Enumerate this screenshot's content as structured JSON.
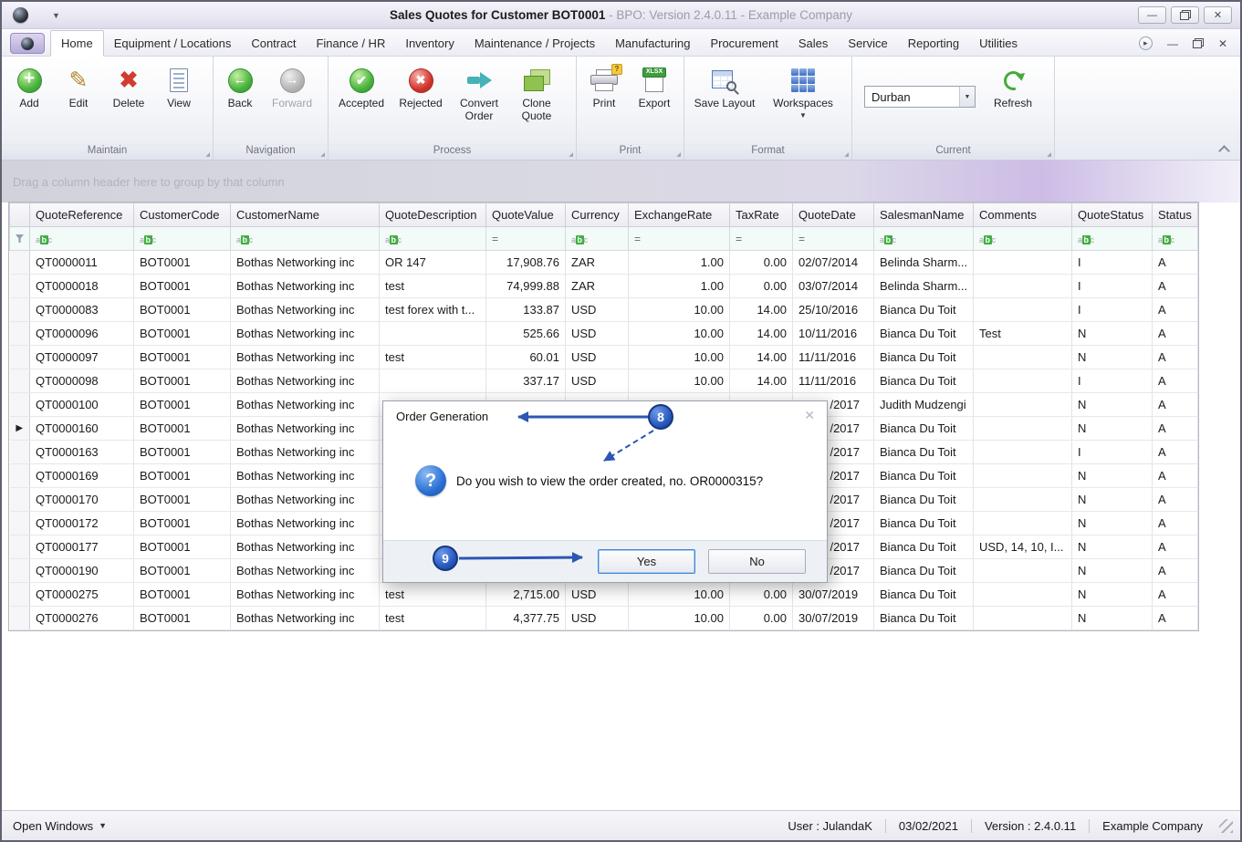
{
  "titlebar": {
    "title_bold": "Sales Quotes for Customer BOT0001",
    "title_rest": " - BPO: Version 2.4.0.11 - Example Company"
  },
  "menu": {
    "tabs": [
      {
        "label": "Home",
        "active": true
      },
      {
        "label": "Equipment / Locations"
      },
      {
        "label": "Contract"
      },
      {
        "label": "Finance / HR"
      },
      {
        "label": "Inventory"
      },
      {
        "label": "Maintenance / Projects"
      },
      {
        "label": "Manufacturing"
      },
      {
        "label": "Procurement"
      },
      {
        "label": "Sales"
      },
      {
        "label": "Service"
      },
      {
        "label": "Reporting"
      },
      {
        "label": "Utilities"
      }
    ]
  },
  "ribbon": {
    "groups": [
      {
        "label": "Maintain",
        "buttons": [
          {
            "label": "Add"
          },
          {
            "label": "Edit"
          },
          {
            "label": "Delete"
          },
          {
            "label": "View"
          }
        ]
      },
      {
        "label": "Navigation",
        "buttons": [
          {
            "label": "Back"
          },
          {
            "label": "Forward"
          }
        ]
      },
      {
        "label": "Process",
        "buttons": [
          {
            "label": "Accepted"
          },
          {
            "label": "Rejected"
          },
          {
            "label": "Convert Order"
          },
          {
            "label": "Clone Quote"
          }
        ]
      },
      {
        "label": "Print",
        "buttons": [
          {
            "label": "Print"
          },
          {
            "label": "Export"
          }
        ]
      },
      {
        "label": "Format",
        "buttons": [
          {
            "label": "Save Layout"
          },
          {
            "label": "Workspaces"
          }
        ]
      },
      {
        "label": "Current",
        "combo_value": "Durban",
        "buttons": [
          {
            "label": "Refresh"
          }
        ]
      }
    ]
  },
  "grid": {
    "group_panel_text": "Drag a column header here to group by that column",
    "columns": [
      {
        "label": "QuoteReference",
        "filter": "abc"
      },
      {
        "label": "CustomerCode",
        "filter": "abc"
      },
      {
        "label": "CustomerName",
        "filter": "abc"
      },
      {
        "label": "QuoteDescription",
        "filter": "abc"
      },
      {
        "label": "QuoteValue",
        "filter": "eq"
      },
      {
        "label": "Currency",
        "filter": "abc"
      },
      {
        "label": "ExchangeRate",
        "filter": "eq"
      },
      {
        "label": "TaxRate",
        "filter": "eq"
      },
      {
        "label": "QuoteDate",
        "filter": "eq"
      },
      {
        "label": "SalesmanName",
        "filter": "abc"
      },
      {
        "label": "Comments",
        "filter": "abc"
      },
      {
        "label": "QuoteStatus",
        "filter": "abc"
      },
      {
        "label": "Status",
        "filter": "abc"
      }
    ],
    "rows": [
      {
        "cells": [
          "QT0000011",
          "BOT0001",
          "Bothas Networking inc",
          "OR 147",
          "17,908.76",
          "ZAR",
          "1.00",
          "0.00",
          "02/07/2014",
          "Belinda Sharm...",
          "",
          "I",
          "A"
        ]
      },
      {
        "cells": [
          "QT0000018",
          "BOT0001",
          "Bothas Networking inc",
          "test",
          "74,999.88",
          "ZAR",
          "1.00",
          "0.00",
          "03/07/2014",
          "Belinda Sharm...",
          "",
          "I",
          "A"
        ]
      },
      {
        "cells": [
          "QT0000083",
          "BOT0001",
          "Bothas Networking inc",
          "test forex with t...",
          "133.87",
          "USD",
          "10.00",
          "14.00",
          "25/10/2016",
          "Bianca Du Toit",
          "",
          "I",
          "A"
        ]
      },
      {
        "cells": [
          "QT0000096",
          "BOT0001",
          "Bothas Networking inc",
          "",
          "525.66",
          "USD",
          "10.00",
          "14.00",
          "10/11/2016",
          "Bianca Du Toit",
          "Test",
          "N",
          "A"
        ]
      },
      {
        "cells": [
          "QT0000097",
          "BOT0001",
          "Bothas Networking inc",
          "test",
          "60.01",
          "USD",
          "10.00",
          "14.00",
          "11/11/2016",
          "Bianca Du Toit",
          "",
          "N",
          "A"
        ]
      },
      {
        "cells": [
          "QT0000098",
          "BOT0001",
          "Bothas Networking inc",
          "",
          "337.17",
          "USD",
          "10.00",
          "14.00",
          "11/11/2016",
          "Bianca Du Toit",
          "",
          "I",
          "A"
        ]
      },
      {
        "cells": [
          "QT0000100",
          "BOT0001",
          "Bothas Networking inc",
          "",
          "",
          "",
          "",
          "",
          "/2017",
          "Judith Mudzengi",
          "",
          "N",
          "A"
        ]
      },
      {
        "cells": [
          "QT0000160",
          "BOT0001",
          "Bothas Networking inc",
          "",
          "",
          "",
          "",
          "",
          "/2017",
          "Bianca Du Toit",
          "",
          "N",
          "A"
        ],
        "focused": true
      },
      {
        "cells": [
          "QT0000163",
          "BOT0001",
          "Bothas Networking inc",
          "",
          "",
          "",
          "",
          "",
          "/2017",
          "Bianca Du Toit",
          "",
          "I",
          "A"
        ]
      },
      {
        "cells": [
          "QT0000169",
          "BOT0001",
          "Bothas Networking inc",
          "",
          "",
          "",
          "",
          "",
          "/2017",
          "Bianca Du Toit",
          "",
          "N",
          "A"
        ]
      },
      {
        "cells": [
          "QT0000170",
          "BOT0001",
          "Bothas Networking inc",
          "",
          "",
          "",
          "",
          "",
          "/2017",
          "Bianca Du Toit",
          "",
          "N",
          "A"
        ]
      },
      {
        "cells": [
          "QT0000172",
          "BOT0001",
          "Bothas Networking inc",
          "",
          "",
          "",
          "",
          "",
          "/2017",
          "Bianca Du Toit",
          "",
          "N",
          "A"
        ]
      },
      {
        "cells": [
          "QT0000177",
          "BOT0001",
          "Bothas Networking inc",
          "",
          "",
          "",
          "",
          "",
          "/2017",
          "Bianca Du Toit",
          "USD, 14, 10, I...",
          "N",
          "A"
        ]
      },
      {
        "cells": [
          "QT0000190",
          "BOT0001",
          "Bothas Networking inc",
          "",
          "",
          "",
          "",
          "",
          "/2017",
          "Bianca Du Toit",
          "",
          "N",
          "A"
        ]
      },
      {
        "cells": [
          "QT0000275",
          "BOT0001",
          "Bothas Networking inc",
          "test",
          "2,715.00",
          "USD",
          "10.00",
          "0.00",
          "30/07/2019",
          "Bianca Du Toit",
          "",
          "N",
          "A"
        ]
      },
      {
        "cells": [
          "QT0000276",
          "BOT0001",
          "Bothas Networking inc",
          "test",
          "4,377.75",
          "USD",
          "10.00",
          "0.00",
          "30/07/2019",
          "Bianca Du Toit",
          "",
          "N",
          "A"
        ]
      }
    ]
  },
  "dialog": {
    "title": "Order Generation",
    "message": "Do you wish to view the order created, no. OR0000315?",
    "yes_label": "Yes",
    "no_label": "No"
  },
  "annotations": {
    "badge8": "8",
    "badge9": "9"
  },
  "statusbar": {
    "open_windows": "Open Windows",
    "user": "User : JulandaK",
    "date": "03/02/2021",
    "version": "Version : 2.4.0.11",
    "company": "Example Company"
  }
}
